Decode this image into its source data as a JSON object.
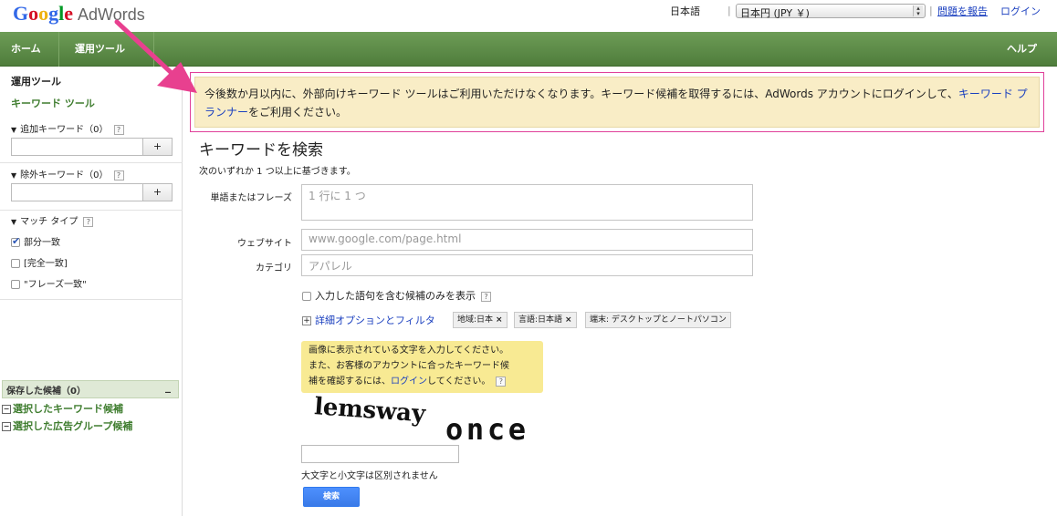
{
  "brand": {
    "logo_letters": [
      "G",
      "o",
      "o",
      "g",
      "l",
      "e"
    ],
    "product": "AdWords"
  },
  "header": {
    "language": "日本語",
    "currency": "日本円 (JPY ￥)",
    "report_link": "問題を報告",
    "login_link": "ログイン"
  },
  "nav": {
    "home": "ホーム",
    "tools": "運用ツール",
    "help": "ヘルプ"
  },
  "sidebar": {
    "title": "運用ツール",
    "keyword_tool": "キーワード ツール",
    "add_keywords": "追加キーワード（0）",
    "exclude_keywords": "除外キーワード（0）",
    "plus": "+",
    "match_type": "マッチ タイプ",
    "help_mark": "?",
    "match_options": [
      {
        "label": "部分一致",
        "checked": true
      },
      {
        "label": "[完全一致]",
        "checked": false
      },
      {
        "label": "\"フレーズ一致\"",
        "checked": false
      }
    ],
    "saved": {
      "title": "保存した候補（0）",
      "minimize": "_",
      "items": [
        "選択したキーワード候補",
        "選択した広告グループ候補"
      ]
    }
  },
  "notice": {
    "text_before": "今後数か月以内に、外部向けキーワード ツールはご利用いただけなくなります。キーワード候補を取得するには、AdWords アカウントにログインして、",
    "link": "キーワード プランナー",
    "text_after": "をご利用ください。"
  },
  "form": {
    "title": "キーワードを検索",
    "subtitle": "次のいずれか 1 つ以上に基づきます。",
    "phrase_label": "単語またはフレーズ",
    "phrase_placeholder": "1 行に 1 つ",
    "website_label": "ウェブサイト",
    "website_placeholder": "www.google.com/page.html",
    "category_label": "カテゴリ",
    "category_placeholder": "アパレル",
    "only_include": "入力した語句を含む候補のみを表示",
    "advanced": "詳細オプションとフィルタ",
    "chips": [
      "地域:日本",
      "言語:日本語",
      "端末: デスクトップとノートパソコン"
    ],
    "captcha": {
      "line1": "画像に表示されている文字を入力してください。",
      "line2": "また、お客様のアカウントに合ったキーワード候",
      "line3_before": "補を確認するには、",
      "line3_link": "ログイン",
      "line3_after": "してください。",
      "word1": "lemsway",
      "word2": "once"
    },
    "case_note": "大文字と小文字は区別されません",
    "search_button": "検索"
  },
  "colors": {
    "nav_green": "#5b8b47",
    "notice_bg": "#f9edc6",
    "highlight_border": "#e0409a",
    "arrow": "#e8408f",
    "link": "#1a3fbf",
    "button": "#4d90fe"
  }
}
